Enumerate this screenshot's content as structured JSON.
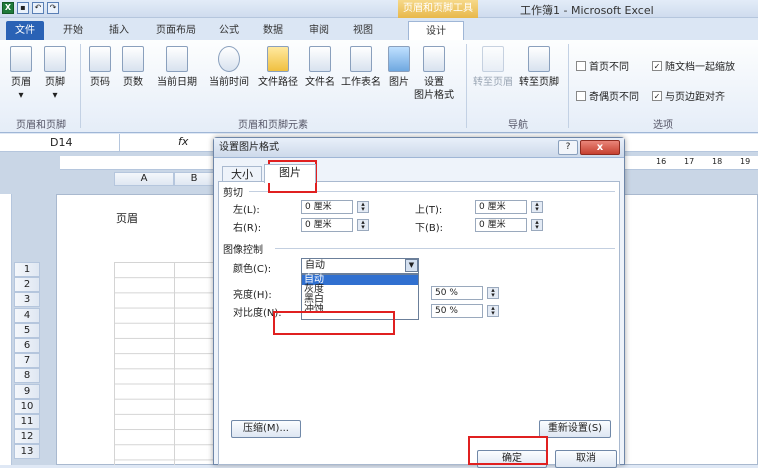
{
  "window": {
    "title": "工作簿1 - Microsoft Excel",
    "context_tab": "页眉和页脚工具"
  },
  "tabs": [
    "文件",
    "开始",
    "插入",
    "页面布局",
    "公式",
    "数据",
    "审阅",
    "视图",
    "设计"
  ],
  "ribbon": {
    "buttons": [
      "页眉",
      "页脚",
      "页码",
      "页数",
      "当前日期",
      "当前时间",
      "文件路径",
      "文件名",
      "工作表名",
      "图片",
      "设置\n图片格式",
      "转至页眉",
      "转至页脚"
    ],
    "groups": [
      "页眉和页脚",
      "页眉和页脚元素",
      "导航",
      "选项"
    ],
    "options": [
      {
        "label": "首页不同",
        "checked": false
      },
      {
        "label": "随文档一起缩放",
        "checked": true
      },
      {
        "label": "奇偶页不同",
        "checked": false
      },
      {
        "label": "与页边距对齐",
        "checked": true
      }
    ]
  },
  "formula_bar": {
    "name_box": "D14",
    "fx": "fx"
  },
  "sheet": {
    "columns": [
      "A",
      "B"
    ],
    "header_label": "页眉",
    "rows": [
      "1",
      "2",
      "3",
      "4",
      "5",
      "6",
      "7",
      "8",
      "9",
      "10",
      "11",
      "12",
      "13"
    ],
    "ruler_right": [
      "16",
      "17",
      "18",
      "19"
    ]
  },
  "dialog": {
    "title": "设置图片格式",
    "help": "?",
    "close": "x",
    "tabs": [
      "大小",
      "图片"
    ],
    "crop_section": "剪切",
    "crop": {
      "left_label": "左(L):",
      "left_value": "0 厘米",
      "right_label": "右(R):",
      "right_value": "0 厘米",
      "top_label": "上(T):",
      "top_value": "0 厘米",
      "bottom_label": "下(B):",
      "bottom_value": "0 厘米"
    },
    "image_section": "图像控制",
    "color_label": "颜色(C):",
    "color_value": "自动",
    "color_options": [
      "自动",
      "灰度",
      "黑白",
      "冲蚀"
    ],
    "brightness_label": "亮度(H):",
    "brightness_value": "50 %",
    "contrast_label": "对比度(N):",
    "contrast_value": "50 %",
    "compress_button": "压缩(M)...",
    "reset_button": "重新设置(S)",
    "ok_button": "确定",
    "cancel_button": "取消"
  }
}
